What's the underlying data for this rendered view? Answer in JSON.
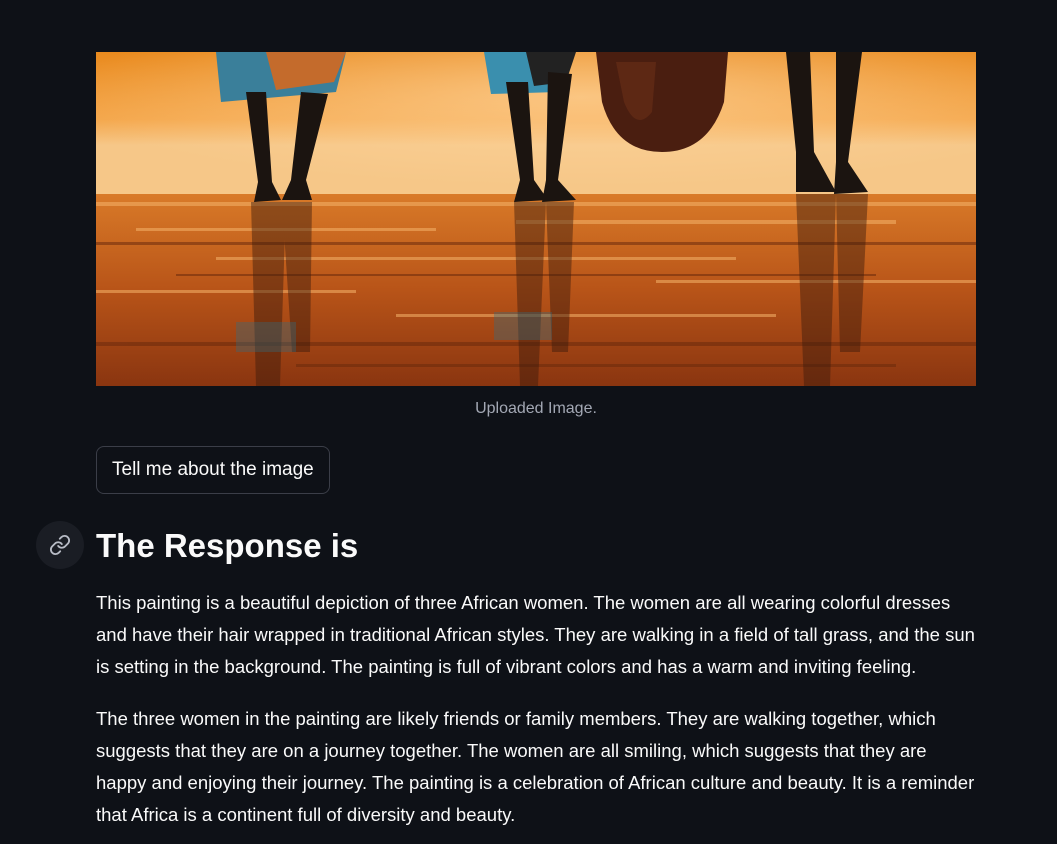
{
  "image": {
    "caption": "Uploaded Image.",
    "icon": "painting-image"
  },
  "prompt_button": {
    "label": "Tell me about the image"
  },
  "response": {
    "heading": "The Response is",
    "anchor_icon": "link-icon",
    "paragraphs": [
      "This painting is a beautiful depiction of three African women. The women are all wearing colorful dresses and have their hair wrapped in traditional African styles. They are walking in a field of tall grass, and the sun is setting in the background. The painting is full of vibrant colors and has a warm and inviting feeling.",
      "The three women in the painting are likely friends or family members. They are walking together, which suggests that they are on a journey together. The women are all smiling, which suggests that they are happy and enjoying their journey. The painting is a celebration of African culture and beauty. It is a reminder that Africa is a continent full of diversity and beauty."
    ]
  },
  "colors": {
    "background": "#0e1117",
    "text": "#fafafa",
    "caption": "#a3a8b4",
    "button_border": "#3b3e48"
  }
}
